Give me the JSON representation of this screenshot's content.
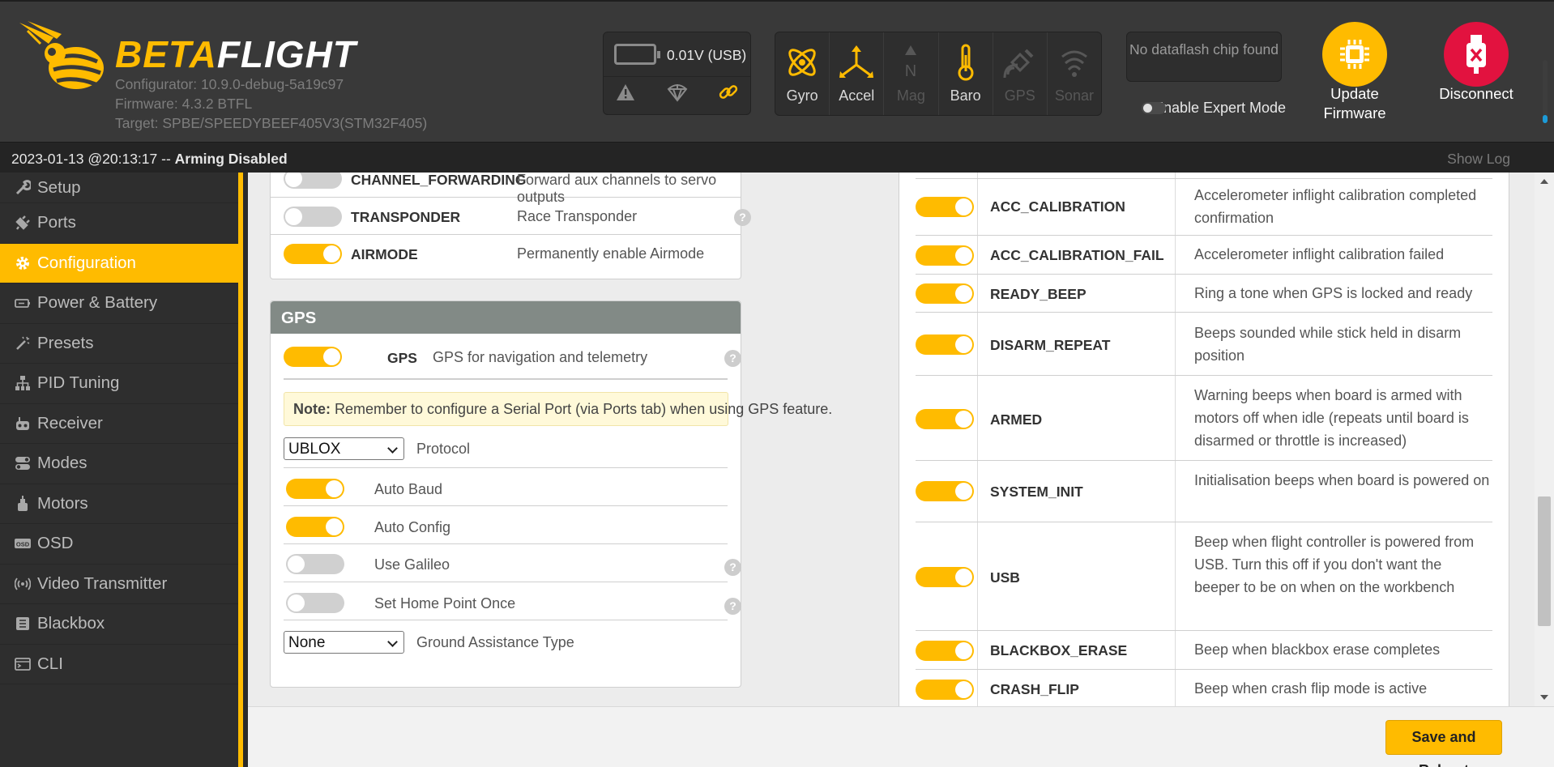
{
  "header": {
    "brand_part1": "BETA",
    "brand_part2": "FLIGHT",
    "configurator": "Configurator: 10.9.0-debug-5a19c97",
    "firmware": "Firmware: 4.3.2 BTFL",
    "target": "Target: SPBE/SPEEDYBEEF405V3(STM32F405)",
    "battery_voltage": "0.01V (USB)",
    "sensors": [
      {
        "label": "Gyro",
        "icon": "gyro-icon",
        "active": true
      },
      {
        "label": "Accel",
        "icon": "accel-icon",
        "active": true
      },
      {
        "label": "Mag",
        "icon": "mag-icon",
        "active": false
      },
      {
        "label": "Baro",
        "icon": "baro-icon",
        "active": true
      },
      {
        "label": "GPS",
        "icon": "gps-icon",
        "active": false
      },
      {
        "label": "Sonar",
        "icon": "sonar-icon",
        "active": false
      }
    ],
    "dataflash": "No dataflash chip found",
    "expert_mode": "Enable Expert Mode",
    "update_firmware": "Update Firmware",
    "disconnect": "Disconnect"
  },
  "status_bar": {
    "timestamp": "2023-01-13 @20:13:17 -- ",
    "state": "Arming Disabled",
    "show_log": "Show Log"
  },
  "sidebar": {
    "items": [
      {
        "label": "Setup",
        "icon": "wrench-icon"
      },
      {
        "label": "Ports",
        "icon": "plug-icon"
      },
      {
        "label": "Configuration",
        "icon": "gear-icon",
        "active": true
      },
      {
        "label": "Power & Battery",
        "icon": "battery-icon"
      },
      {
        "label": "Presets",
        "icon": "wand-icon"
      },
      {
        "label": "PID Tuning",
        "icon": "sitemap-icon"
      },
      {
        "label": "Receiver",
        "icon": "receiver-icon"
      },
      {
        "label": "Modes",
        "icon": "toggle-icon"
      },
      {
        "label": "Motors",
        "icon": "motor-icon"
      },
      {
        "label": "OSD",
        "icon": "osd-icon"
      },
      {
        "label": "Video Transmitter",
        "icon": "broadcast-icon"
      },
      {
        "label": "Blackbox",
        "icon": "blackbox-icon"
      },
      {
        "label": "CLI",
        "icon": "terminal-icon"
      }
    ]
  },
  "features": [
    {
      "name": "CHANNEL_FORWARDING",
      "desc": "Forward aux channels to servo outputs",
      "enabled": false,
      "help": false
    },
    {
      "name": "TRANSPONDER",
      "desc": "Race Transponder",
      "enabled": false,
      "help": true
    },
    {
      "name": "AIRMODE",
      "desc": "Permanently enable Airmode",
      "enabled": true,
      "help": false
    }
  ],
  "gps": {
    "title": "GPS",
    "feature_name": "GPS",
    "feature_desc": "GPS for navigation and telemetry",
    "feature_enabled": true,
    "note_label": "Note:",
    "note_text": " Remember to configure a Serial Port (via Ports tab) when using GPS feature.",
    "protocol_value": "UBLOX",
    "protocol_label": "Protocol",
    "auto_baud": "Auto Baud",
    "auto_baud_enabled": true,
    "auto_config": "Auto Config",
    "auto_config_enabled": true,
    "use_galileo": "Use Galileo",
    "use_galileo_enabled": false,
    "home_point_once": "Set Home Point Once",
    "home_point_once_enabled": false,
    "ground_assist_value": "None",
    "ground_assist_label": "Ground Assistance Type"
  },
  "beeper": [
    {
      "name": "ACC_CALIBRATION",
      "desc": "Accelerometer inflight calibration completed confirmation",
      "enabled": true
    },
    {
      "name": "ACC_CALIBRATION_FAIL",
      "desc": "Accelerometer inflight calibration failed",
      "enabled": true
    },
    {
      "name": "READY_BEEP",
      "desc": "Ring a tone when GPS is locked and ready",
      "enabled": true
    },
    {
      "name": "DISARM_REPEAT",
      "desc": "Beeps sounded while stick held in disarm position",
      "enabled": true
    },
    {
      "name": "ARMED",
      "desc": "Warning beeps when board is armed with motors off when idle (repeats until board is disarmed or throttle is increased)",
      "enabled": true
    },
    {
      "name": "SYSTEM_INIT",
      "desc": "Initialisation beeps when board is powered on",
      "enabled": true
    },
    {
      "name": "USB",
      "desc": "Beep when flight controller is powered from USB. Turn this off if you don't want the beeper to be on when on the workbench",
      "enabled": true
    },
    {
      "name": "BLACKBOX_ERASE",
      "desc": "Beep when blackbox erase completes",
      "enabled": true
    },
    {
      "name": "CRASH_FLIP",
      "desc": "Beep when crash flip mode is active",
      "enabled": true
    }
  ],
  "footer": {
    "save_reboot": "Save and Reboot"
  },
  "colors": {
    "accent": "#ffbb00",
    "header_bg": "#393939",
    "sidebar_bg": "#2e2e2e",
    "disconnect": "#e2123f"
  }
}
